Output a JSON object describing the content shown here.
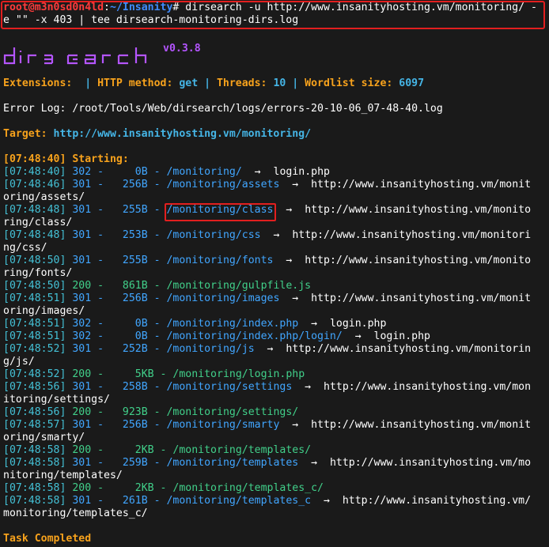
{
  "prompt": {
    "user_host": "root@m3n0sd0n4ld",
    "sep": ":",
    "path": "~/Insanity",
    "command_line1": "# dirsearch -u http://www.insanityhosting.vm/monitoring/ -",
    "command_line2": "e \"\" -x 403 | tee dirsearch-monitoring-dirs.log"
  },
  "banner": {
    "logo_text": "dirsearch",
    "version": "v0.3.8"
  },
  "config": {
    "extensions_label": "Extensions: ",
    "sep": " | ",
    "http_method_label": "HTTP method: ",
    "http_method": "get",
    "threads_label": "Threads: ",
    "threads": "10",
    "wordlist_label": "Wordlist size: ",
    "wordlist_size": "6097"
  },
  "error_log": "Error Log: /root/Tools/Web/dirsearch/logs/errors-20-10-06_07-48-40.log",
  "target": {
    "label": "Target: ",
    "url": "http://www.insanityhosting.vm/monitoring/"
  },
  "starting": "[07:48:40] Starting:",
  "results": [
    {
      "ts": "[07:48:40]",
      "code": "302",
      "size": "    0B",
      "path": "/monitoring/",
      "redirect": "login.php",
      "cont": ""
    },
    {
      "ts": "[07:48:46]",
      "code": "301",
      "size": "  256B",
      "path": "/monitoring/assets",
      "redirect": "http://www.insanityhosting.vm/monit",
      "cont": "oring/assets/"
    },
    {
      "ts": "[07:48:48]",
      "code": "301",
      "size": "  255B",
      "path": "/monitoring/class",
      "redirect": "http://www.insanityhosting.vm/monito",
      "cont": "ring/class/"
    },
    {
      "ts": "[07:48:48]",
      "code": "301",
      "size": "  253B",
      "path": "/monitoring/css",
      "redirect": "http://www.insanityhosting.vm/monitori",
      "cont": "ng/css/"
    },
    {
      "ts": "[07:48:50]",
      "code": "301",
      "size": "  255B",
      "path": "/monitoring/fonts",
      "redirect": "http://www.insanityhosting.vm/monito",
      "cont": "ring/fonts/"
    },
    {
      "ts": "[07:48:50]",
      "code": "200",
      "size": "  861B",
      "path": "/monitoring/gulpfile.js",
      "redirect": "",
      "cont": ""
    },
    {
      "ts": "[07:48:51]",
      "code": "301",
      "size": "  256B",
      "path": "/monitoring/images",
      "redirect": "http://www.insanityhosting.vm/monit",
      "cont": "oring/images/"
    },
    {
      "ts": "[07:48:51]",
      "code": "302",
      "size": "    0B",
      "path": "/monitoring/index.php",
      "redirect": "login.php",
      "cont": ""
    },
    {
      "ts": "[07:48:51]",
      "code": "302",
      "size": "    0B",
      "path": "/monitoring/index.php/login/",
      "redirect": "login.php",
      "cont": ""
    },
    {
      "ts": "[07:48:52]",
      "code": "301",
      "size": "  252B",
      "path": "/monitoring/js",
      "redirect": "http://www.insanityhosting.vm/monitorin",
      "cont": "g/js/"
    },
    {
      "ts": "[07:48:52]",
      "code": "200",
      "size": "    5KB",
      "path": "/monitoring/login.php",
      "redirect": "",
      "cont": ""
    },
    {
      "ts": "[07:48:56]",
      "code": "301",
      "size": "  258B",
      "path": "/monitoring/settings",
      "redirect": "http://www.insanityhosting.vm/mon",
      "cont": "itoring/settings/"
    },
    {
      "ts": "[07:48:56]",
      "code": "200",
      "size": "  923B",
      "path": "/monitoring/settings/",
      "redirect": "",
      "cont": ""
    },
    {
      "ts": "[07:48:57]",
      "code": "301",
      "size": "  256B",
      "path": "/monitoring/smarty",
      "redirect": "http://www.insanityhosting.vm/monit",
      "cont": "oring/smarty/"
    },
    {
      "ts": "[07:48:58]",
      "code": "200",
      "size": "    2KB",
      "path": "/monitoring/templates/",
      "redirect": "",
      "cont": ""
    },
    {
      "ts": "[07:48:58]",
      "code": "301",
      "size": "  259B",
      "path": "/monitoring/templates",
      "redirect": "http://www.insanityhosting.vm/mo",
      "cont": "nitoring/templates/"
    },
    {
      "ts": "[07:48:58]",
      "code": "200",
      "size": "    2KB",
      "path": "/monitoring/templates_c/",
      "redirect": "",
      "cont": ""
    },
    {
      "ts": "[07:48:58]",
      "code": "301",
      "size": "  261B",
      "path": "/monitoring/templates_c",
      "redirect": "http://www.insanityhosting.vm/",
      "cont": "monitoring/templates_c/"
    }
  ],
  "arrow": "→",
  "dash": " - ",
  "completed": "Task Completed",
  "colors": {
    "prompt_red": "#ff3b3b",
    "path_blue": "#3f8cff",
    "accent_orange": "#f7a21c",
    "cyan": "#44c1d6",
    "green": "#41d08a",
    "purple": "#b455ff",
    "highlight_box": "#e21f1f",
    "background": "#1a1a1a"
  }
}
